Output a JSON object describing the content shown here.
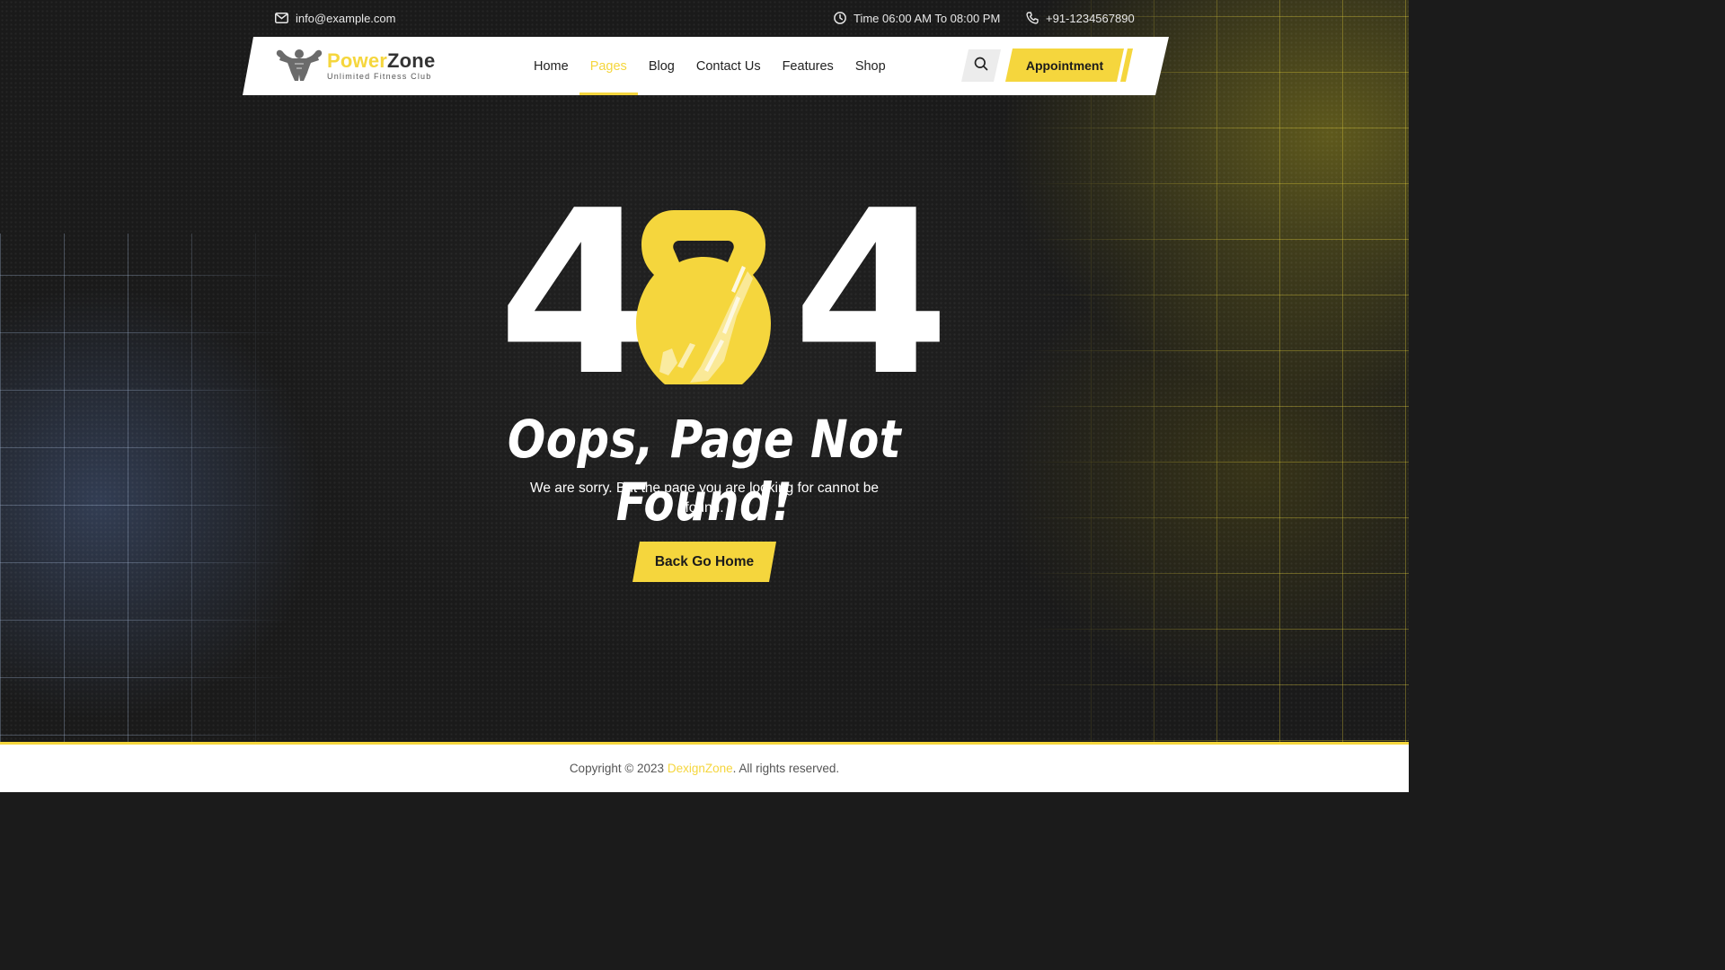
{
  "colors": {
    "accent": "#f5d63d",
    "dark": "#1b1b1b",
    "white": "#ffffff"
  },
  "topbar": {
    "email": "info@example.com",
    "email_icon": "mail-icon",
    "hours": "Time 06:00 AM To 08:00 PM",
    "hours_icon": "clock-icon",
    "phone": "+91-1234567890",
    "phone_icon": "phone-icon"
  },
  "logo": {
    "name_part1": "Power",
    "name_part2": "Zone",
    "tagline": "Unlimited Fitness Club",
    "icon": "bodybuilder-icon"
  },
  "nav": {
    "items": [
      {
        "label": "Home",
        "active": false
      },
      {
        "label": "Pages",
        "active": true
      },
      {
        "label": "Blog",
        "active": false
      },
      {
        "label": "Contact Us",
        "active": false
      },
      {
        "label": "Features",
        "active": false
      },
      {
        "label": "Shop",
        "active": false
      }
    ],
    "search_icon": "search-icon",
    "appointment_label": "Appointment"
  },
  "error": {
    "digit_left": "4",
    "digit_right": "4",
    "middle_icon": "kettlebell-icon",
    "heading": "Oops, Page Not Found!",
    "message": "We are sorry. But the page you are looking for cannot be found.",
    "button_label": "Back Go Home"
  },
  "footer": {
    "prefix": "Copyright © 2023 ",
    "brand": "DexignZone",
    "suffix": ". All rights reserved."
  }
}
